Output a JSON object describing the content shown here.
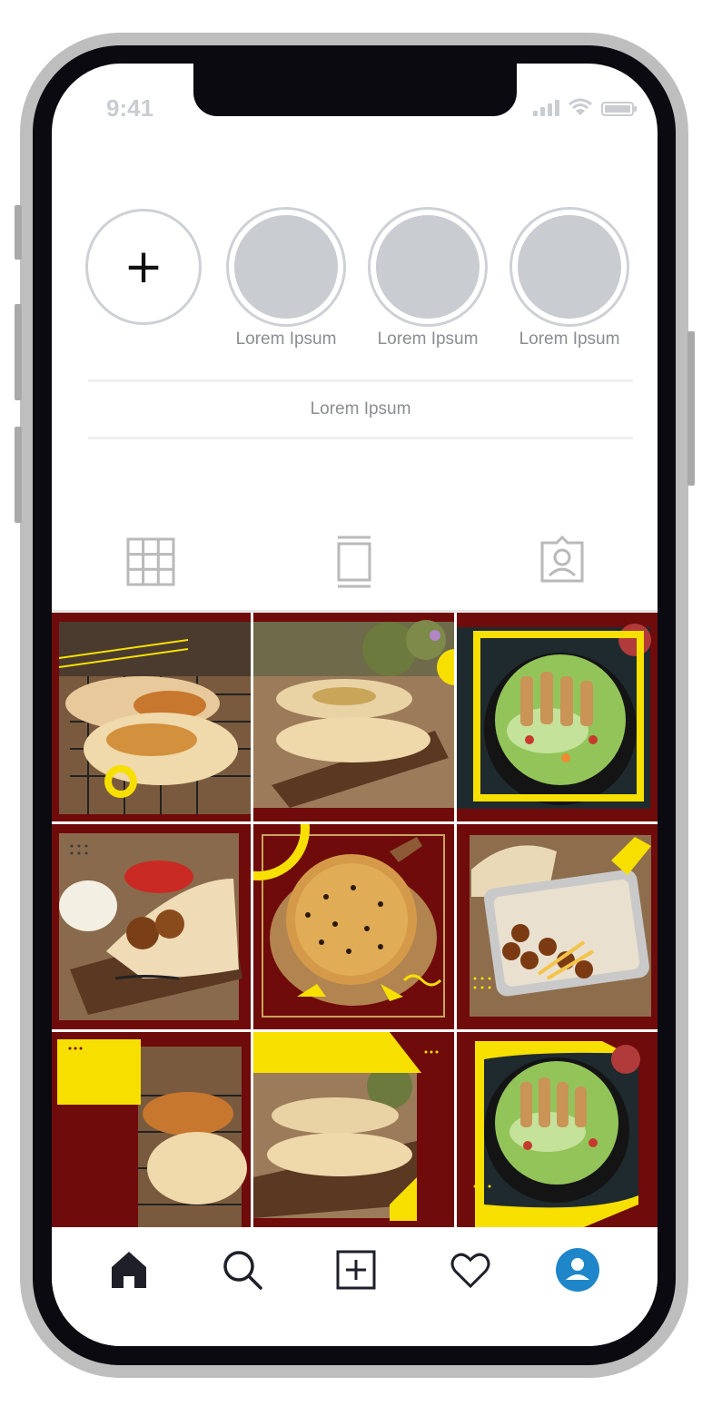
{
  "status_bar": {
    "time": "9:41"
  },
  "stories": {
    "new_icon": "plus-icon",
    "items": [
      {
        "label": "Lorem Ipsum"
      },
      {
        "label": "Lorem Ipsum"
      },
      {
        "label": "Lorem Ipsum"
      }
    ]
  },
  "profile": {
    "center_text": "Lorem Ipsum"
  },
  "tabs": [
    {
      "icon": "grid-icon"
    },
    {
      "icon": "reels-icon"
    },
    {
      "icon": "tagged-icon"
    }
  ],
  "posts": [
    {
      "content": "wrap-pastry-photo"
    },
    {
      "content": "stuffed-flatbread-photo"
    },
    {
      "content": "grilled-chicken-salad-photo"
    },
    {
      "content": "falafel-wrap-photo"
    },
    {
      "content": "pizza-photo"
    },
    {
      "content": "falafel-platter-photo"
    },
    {
      "content": "wrap-pastry-photo"
    },
    {
      "content": "stuffed-flatbread-photo"
    },
    {
      "content": "grilled-chicken-salad-photo"
    }
  ],
  "colors": {
    "brand_maroon": "#6f0b0b",
    "accent_yellow": "#f7e000",
    "profile_blue": "#1f86c9"
  },
  "bottom_nav": [
    {
      "icon": "home-icon"
    },
    {
      "icon": "search-icon"
    },
    {
      "icon": "add-post-icon"
    },
    {
      "icon": "heart-icon"
    },
    {
      "icon": "profile-icon"
    }
  ]
}
